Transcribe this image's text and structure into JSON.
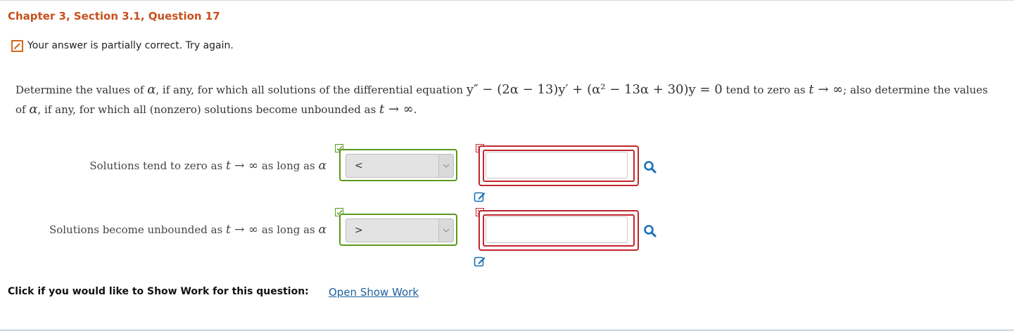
{
  "header": {
    "title": "Chapter 3, Section 3.1, Question 17"
  },
  "status": {
    "icon": "pencil-icon",
    "message": "Your answer is partially correct.  Try again."
  },
  "question": {
    "text_1": "Determine the values of ",
    "alpha": "α",
    "text_2": ", if any, for which all solutions of the differential equation ",
    "equation": "y″ − (2α − 13)y′ + (α² − 13α + 30)y = 0",
    "text_3": " tend to zero as ",
    "limit": "t → ∞",
    "text_4": "; also determine the values of ",
    "text_5": ", if any, for which all (nonzero) solutions become unbounded as ",
    "text_6": "."
  },
  "rows": [
    {
      "label_prefix": "Solutions tend to zero as ",
      "label_limit": "t → ∞",
      "label_suffix": " as long as ",
      "label_var": "α",
      "select_value": "<",
      "select_status": "correct",
      "input_value": "",
      "input_status": "incorrect"
    },
    {
      "label_prefix": "Solutions become unbounded as ",
      "label_limit": "t → ∞",
      "label_suffix": " as long as ",
      "label_var": "α",
      "select_value": ">",
      "select_status": "correct",
      "input_value": "",
      "input_status": "incorrect"
    }
  ],
  "show_work": {
    "label": "Click if you would like to Show Work for this question:",
    "link": "Open Show Work"
  },
  "colors": {
    "title": "#c8501e",
    "correct": "#5a9a1f",
    "incorrect": "#c0272d",
    "link": "#1f5f9c",
    "icon_blue": "#1a6fb5"
  }
}
